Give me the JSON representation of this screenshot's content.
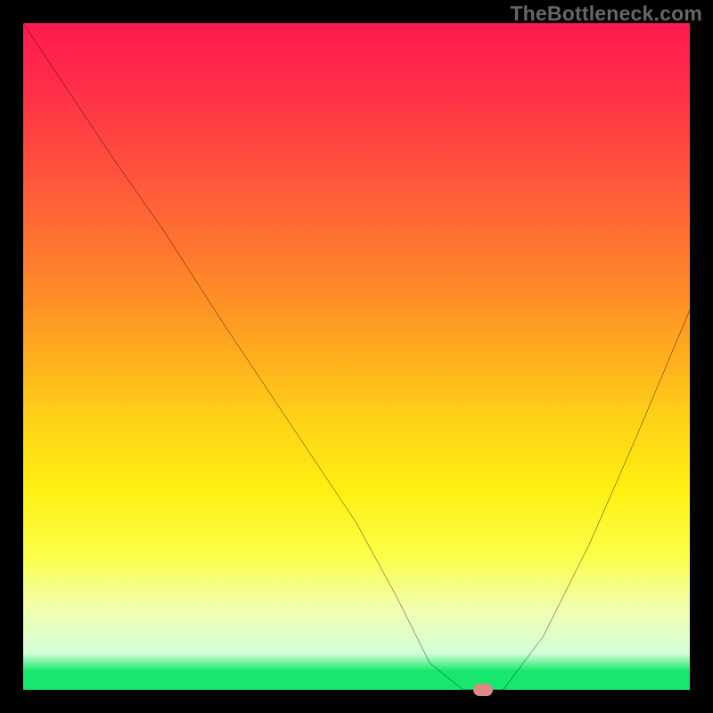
{
  "watermark": "TheBottleneck.com",
  "chart_data": {
    "type": "line",
    "title": "",
    "xlabel": "",
    "ylabel": "",
    "xlim": [
      0,
      100
    ],
    "ylim": [
      0,
      100
    ],
    "series": [
      {
        "name": "bottleneck-curve",
        "x": [
          0,
          14,
          21,
          30,
          40,
          50,
          56,
          61,
          66,
          72,
          78,
          85,
          92,
          100
        ],
        "values": [
          100,
          79,
          69,
          55,
          40,
          25,
          14,
          4,
          0,
          0,
          8,
          22,
          38,
          57
        ]
      }
    ],
    "marker": {
      "x": 69,
      "y": 0,
      "color": "#d98b84"
    },
    "gradient_stops": [
      {
        "pos": 0.0,
        "color": "#ff1a4f"
      },
      {
        "pos": 0.5,
        "color": "#ffae1e"
      },
      {
        "pos": 0.8,
        "color": "#fbff4a"
      },
      {
        "pos": 0.97,
        "color": "#17e86d"
      },
      {
        "pos": 1.0,
        "color": "#17e86d"
      }
    ],
    "grid": false,
    "legend": false
  }
}
